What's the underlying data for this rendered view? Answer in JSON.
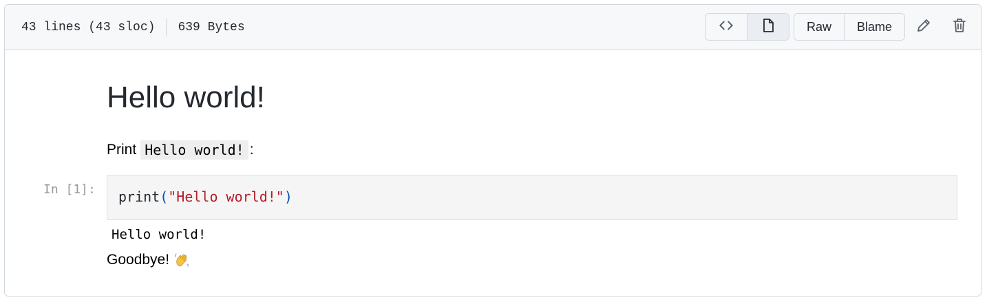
{
  "file_header": {
    "lines_info": "43 lines (43 sloc)",
    "size_info": "639 Bytes",
    "view_buttons": [
      {
        "name": "code-view",
        "icon": "code-icon",
        "selected": false
      },
      {
        "name": "preview",
        "icon": "file-icon",
        "selected": true
      }
    ],
    "raw_label": "Raw",
    "blame_label": "Blame",
    "edit_icon": "pencil-icon",
    "delete_icon": "trash-icon"
  },
  "notebook": {
    "title": "Hello world!",
    "paragraph": {
      "prefix": "Print",
      "code": "Hello world!",
      "suffix": ":"
    },
    "cell": {
      "prompt": "In [1]:",
      "code_tokens": {
        "fn": "print",
        "open_paren": "(",
        "string": "\"Hello world!\"",
        "close_paren": ")"
      },
      "output": "Hello world!"
    },
    "closing": {
      "text": "Goodbye!",
      "emoji": "waving-hand-icon"
    }
  },
  "colors": {
    "header_bg": "#f6f8fa",
    "border": "#d0d7de",
    "string": "#b31d28",
    "paren": "#0550ae",
    "prompt": "#999999"
  }
}
